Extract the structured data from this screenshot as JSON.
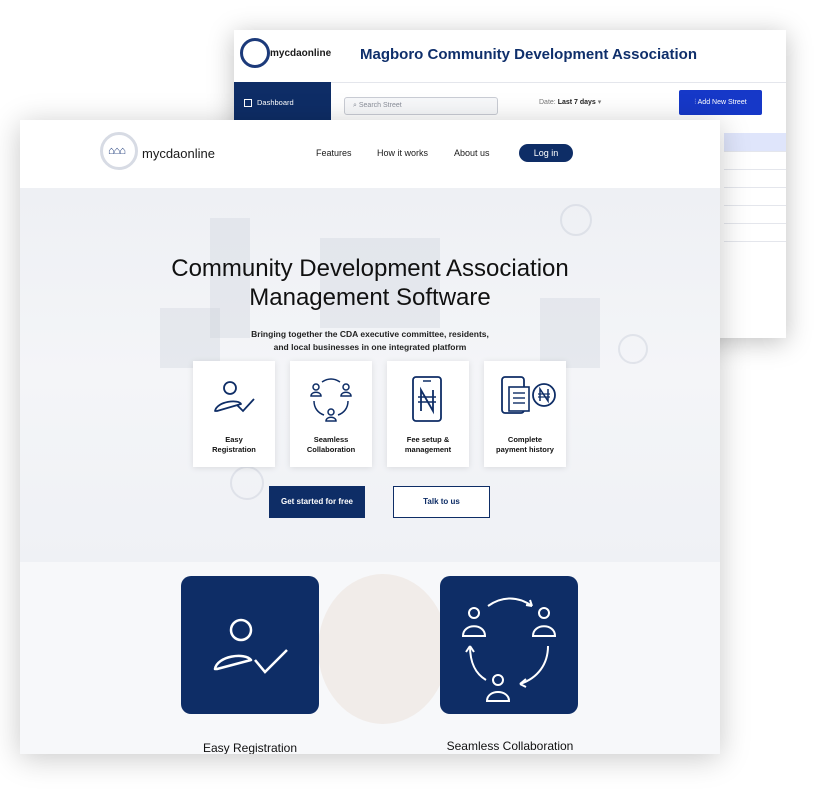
{
  "dashboard": {
    "logo_text": "mycdaonline",
    "title": "Magboro Community Development Association",
    "sidebar_item": "Dashboard",
    "search_placeholder": "Search Street",
    "date_label": "Date:",
    "date_value": "Last 7 days",
    "add_button": "Add New Street"
  },
  "landing": {
    "logo_text": "mycdaonline",
    "nav": {
      "features": "Features",
      "how": "How it works",
      "about": "About us",
      "login": "Log in"
    },
    "hero": {
      "title_line1": "Community Development Association",
      "title_line2": "Management Software",
      "subtitle_line1": "Bringing together the CDA executive committee, residents,",
      "subtitle_line2": "and local businesses in one integrated platform"
    },
    "features": [
      {
        "line1": "Easy",
        "line2": "Registration",
        "icon": "user-check-icon"
      },
      {
        "line1": "Seamless",
        "line2": "Collaboration",
        "icon": "collaboration-cycle-icon"
      },
      {
        "line1": "Fee setup &",
        "line2": "management",
        "icon": "phone-naira-icon"
      },
      {
        "line1": "Complete",
        "line2": "payment history",
        "icon": "receipt-naira-icon"
      }
    ],
    "cta_primary": "Get started for free",
    "cta_secondary": "Talk to us",
    "tiles": [
      {
        "caption": "Easy Registration",
        "icon": "user-check-icon"
      },
      {
        "caption": "Seamless Collaboration",
        "icon": "collaboration-cycle-icon"
      }
    ]
  },
  "colors": {
    "navy": "#0e2d66",
    "accent_blue": "#1638c8",
    "hero_bg": "#eef0f4"
  }
}
